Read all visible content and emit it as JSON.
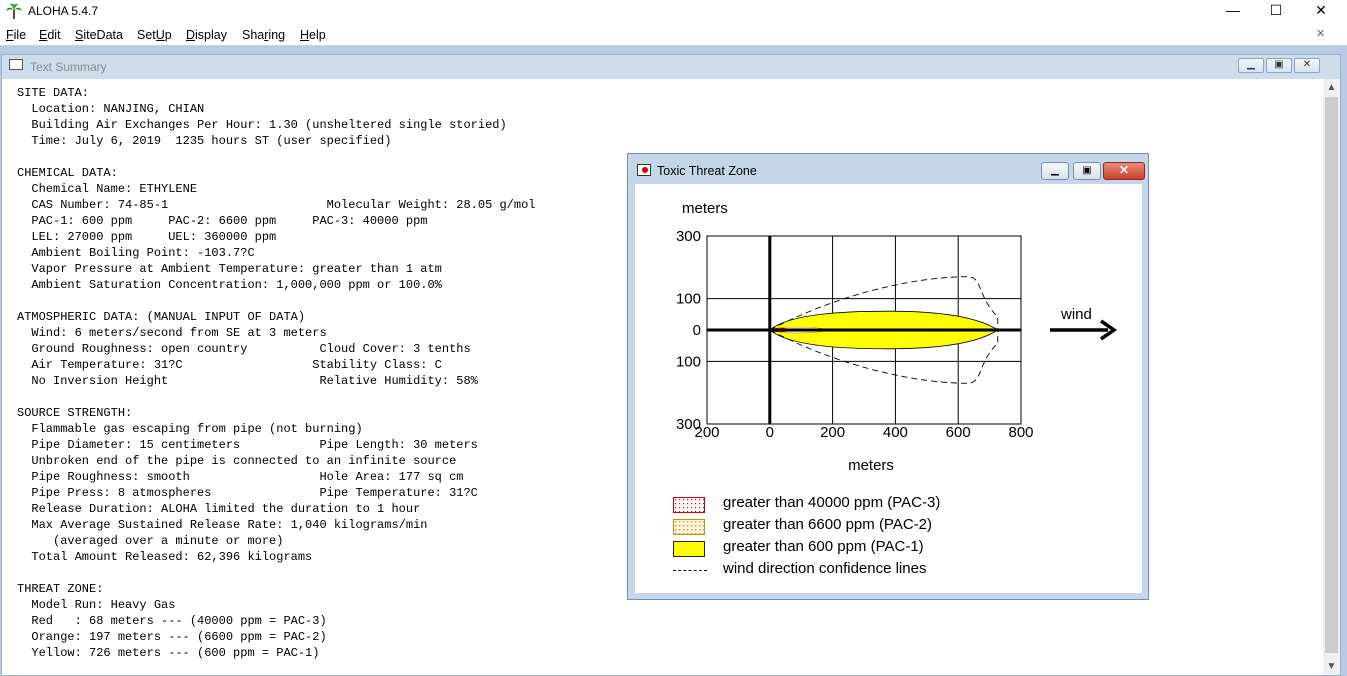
{
  "app": {
    "title": "ALOHA 5.4.7",
    "minimize": "—",
    "maximize": "☐",
    "close": "✕"
  },
  "menu": [
    {
      "label": "File",
      "u": "F",
      "rest": "ile"
    },
    {
      "label": "Edit",
      "u": "E",
      "rest": "dit"
    },
    {
      "label": "SiteData",
      "u": "S",
      "rest": "iteData"
    },
    {
      "label": "SetUp",
      "pre": "Set",
      "u": "U",
      "rest": "p"
    },
    {
      "label": "Display",
      "u": "D",
      "rest": "isplay"
    },
    {
      "label": "Sharing",
      "pre": "Sha",
      "u": "r",
      "rest": "ing"
    },
    {
      "label": "Help",
      "u": "H",
      "rest": "elp"
    }
  ],
  "summary_window": {
    "title": "Text Summary",
    "lines": [
      "SITE DATA:",
      "  Location: NANJING, CHIAN",
      "  Building Air Exchanges Per Hour: 1.30 (unsheltered single storied)",
      "  Time: July 6, 2019  1235 hours ST (user specified)",
      "",
      "CHEMICAL DATA:",
      "  Chemical Name: ETHYLENE",
      "  CAS Number: 74-85-1                      Molecular Weight: 28.05 g/mol",
      "  PAC-1: 600 ppm     PAC-2: 6600 ppm     PAC-3: 40000 ppm",
      "  LEL: 27000 ppm     UEL: 360000 ppm",
      "  Ambient Boiling Point: -103.7?C",
      "  Vapor Pressure at Ambient Temperature: greater than 1 atm",
      "  Ambient Saturation Concentration: 1,000,000 ppm or 100.0%",
      "",
      "ATMOSPHERIC DATA: (MANUAL INPUT OF DATA)",
      "  Wind: 6 meters/second from SE at 3 meters",
      "  Ground Roughness: open country          Cloud Cover: 3 tenths",
      "  Air Temperature: 31?C                  Stability Class: C",
      "  No Inversion Height                     Relative Humidity: 58%",
      "",
      "SOURCE STRENGTH:",
      "  Flammable gas escaping from pipe (not burning)",
      "  Pipe Diameter: 15 centimeters           Pipe Length: 30 meters",
      "  Unbroken end of the pipe is connected to an infinite source",
      "  Pipe Roughness: smooth                  Hole Area: 177 sq cm",
      "  Pipe Press: 8 atmospheres               Pipe Temperature: 31?C",
      "  Release Duration: ALOHA limited the duration to 1 hour",
      "  Max Average Sustained Release Rate: 1,040 kilograms/min",
      "     (averaged over a minute or more)",
      "  Total Amount Released: 62,396 kilograms",
      "",
      "THREAT ZONE:",
      "  Model Run: Heavy Gas",
      "  Red   : 68 meters --- (40000 ppm = PAC-3)",
      "  Orange: 197 meters --- (6600 ppm = PAC-2)",
      "  Yellow: 726 meters --- (600 ppm = PAC-1)"
    ]
  },
  "threat_window": {
    "title": "Toxic Threat Zone",
    "legend": [
      {
        "label": "greater than 40000 ppm (PAC-3)",
        "color": "#ff9a9a",
        "pattern": "red-dots"
      },
      {
        "label": "greater than 6600 ppm (PAC-2)",
        "color": "#ffd9a0",
        "pattern": "orange-dots"
      },
      {
        "label": "greater than 600 ppm (PAC-1)",
        "color": "#ffff00",
        "pattern": "solid"
      },
      {
        "label": "wind direction confidence lines",
        "color": "#000000",
        "pattern": "dashed-line"
      }
    ]
  },
  "chart_data": {
    "type": "threat-zone-footprint",
    "ylabel": "meters",
    "xlabel": "meters",
    "wind_label": "wind",
    "x_ticks": [
      "200",
      "0",
      "200",
      "400",
      "600",
      "800"
    ],
    "x_tick_values": [
      -200,
      0,
      200,
      400,
      600,
      800
    ],
    "y_ticks": [
      "300",
      "100",
      "0",
      "100",
      "300"
    ],
    "y_tick_values": [
      300,
      100,
      0,
      -100,
      -300
    ],
    "xlim": [
      -200,
      800
    ],
    "ylim": [
      -300,
      300
    ],
    "zones": [
      {
        "name": "PAC-3",
        "downwind_m": 68,
        "color": "#ff0000"
      },
      {
        "name": "PAC-2",
        "downwind_m": 197,
        "color": "#ff9900"
      },
      {
        "name": "PAC-1",
        "downwind_m": 726,
        "color": "#ffff00",
        "max_halfwidth_m": 60
      }
    ],
    "confidence_lines_downwind_m": 726,
    "confidence_lines_max_halfwidth_m": 170
  }
}
